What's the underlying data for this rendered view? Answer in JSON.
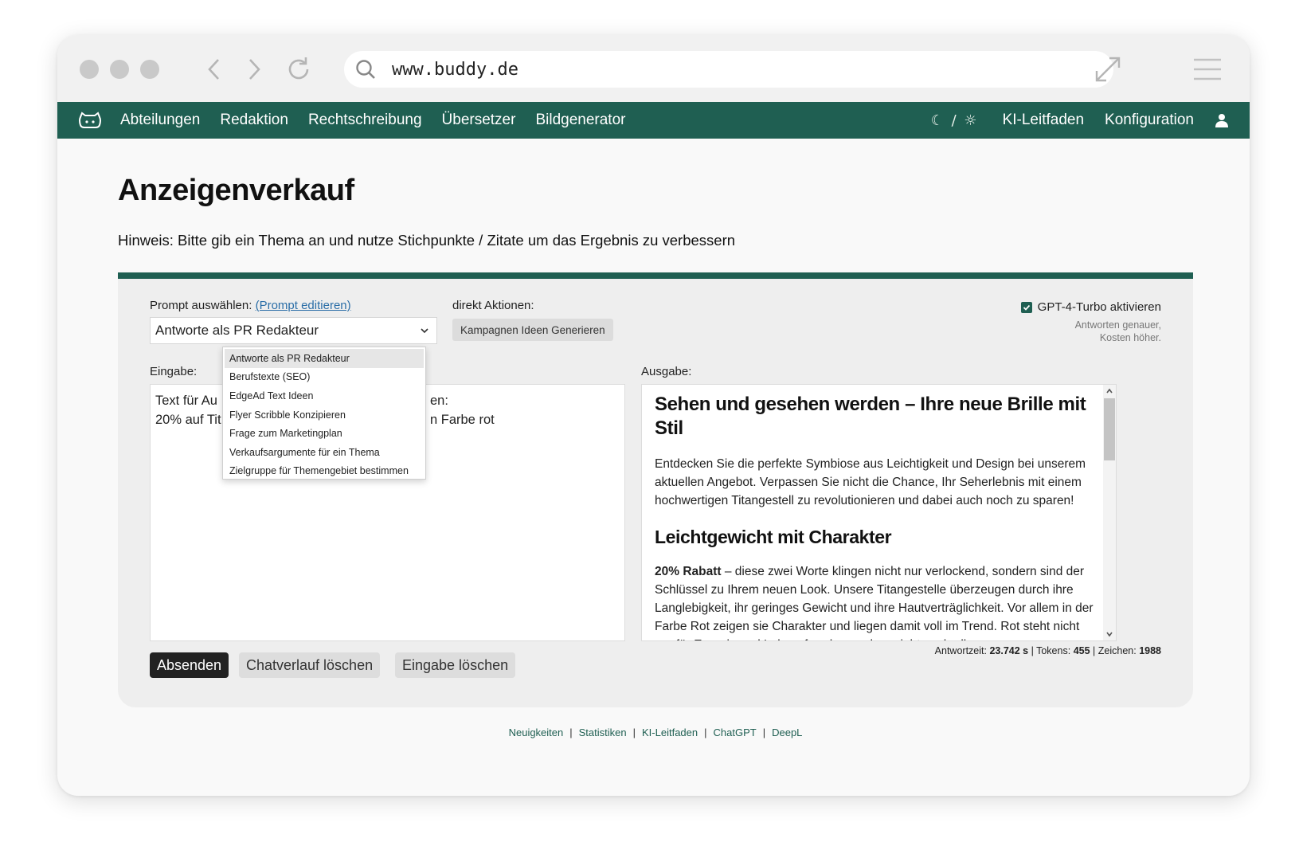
{
  "browser": {
    "url": "www.buddy.de"
  },
  "nav": {
    "links": [
      "Abteilungen",
      "Redaktion",
      "Rechtschreibung",
      "Übersetzer",
      "Bildgenerator"
    ],
    "theme_toggle": "☾ / ☼",
    "guide": "KI-Leitfaden",
    "config": "Konfiguration"
  },
  "page": {
    "title": "Anzeigenverkauf",
    "hint": "Hinweis: Bitte gib ein Thema an und nutze Stichpunkte / Zitate um das Ergebnis zu verbessern"
  },
  "panel": {
    "prompt_label": "Prompt auswählen:",
    "prompt_edit_link": "(Prompt editieren)",
    "selected_prompt": "Antworte als PR Redakteur",
    "actions_label": "direkt Aktionen:",
    "action_button": "Kampagnen Ideen Generieren",
    "gpt_label": "GPT-4-Turbo aktivieren",
    "gpt_note_line1": "Antworten genauer,",
    "gpt_note_line2": "Kosten höher.",
    "input_label": "Eingabe:",
    "output_label": "Ausgabe:",
    "input_line1_visible_start": "Text für Au",
    "input_line1_visible_end": "en:",
    "input_line2_visible_start": "20% auf Tit",
    "input_line2_visible_end": "n Farbe rot",
    "dropdown_options": [
      "Antworte als PR Redakteur",
      "Berufstexte (SEO)",
      "EdgeAd Text Ideen",
      "Flyer Scribble Konzipieren",
      "Frage zum Marketingplan",
      "Verkaufsargumente für ein Thema",
      "Zielgruppe für Themengebiet bestimmen"
    ]
  },
  "output": {
    "heading1": "Sehen und gesehen werden – Ihre neue Brille mit Stil",
    "para1": "Entdecken Sie die perfekte Symbiose aus Leichtigkeit und Design bei unserem aktuellen Angebot. Verpassen Sie nicht die Chance, Ihr Seherlebnis mit einem hochwertigen Titangestell zu revolutionieren und dabei auch noch zu sparen!",
    "heading2": "Leichtgewicht mit Charakter",
    "para2_bold": "20% Rabatt",
    "para2_rest": " – diese zwei Worte klingen nicht nur verlockend, sondern sind der Schlüssel zu Ihrem neuen Look. Unsere Titangestelle überzeugen durch ihre Langlebigkeit, ihr geringes Gewicht und ihre Hautverträglichkeit. Vor allem in der Farbe Rot zeigen sie Charakter und liegen damit voll im Trend. Rot steht nicht nur für Energie und Lebensfreude, sondern zieht auch alle"
  },
  "stats": {
    "time_label": "Antwortzeit:",
    "time_value": "23.742 s",
    "tokens_label": "Tokens:",
    "tokens_value": "455",
    "chars_label": "Zeichen:",
    "chars_value": "1988"
  },
  "buttons": {
    "send": "Absenden",
    "clear_history": "Chatverlauf löschen",
    "clear_input": "Eingabe löschen"
  },
  "footer": {
    "links": [
      "Neuigkeiten",
      "Statistiken",
      "KI-Leitfaden",
      "ChatGPT",
      "DeepL"
    ]
  },
  "colors": {
    "brand": "#1f5f52",
    "primary_button": "#222222"
  }
}
